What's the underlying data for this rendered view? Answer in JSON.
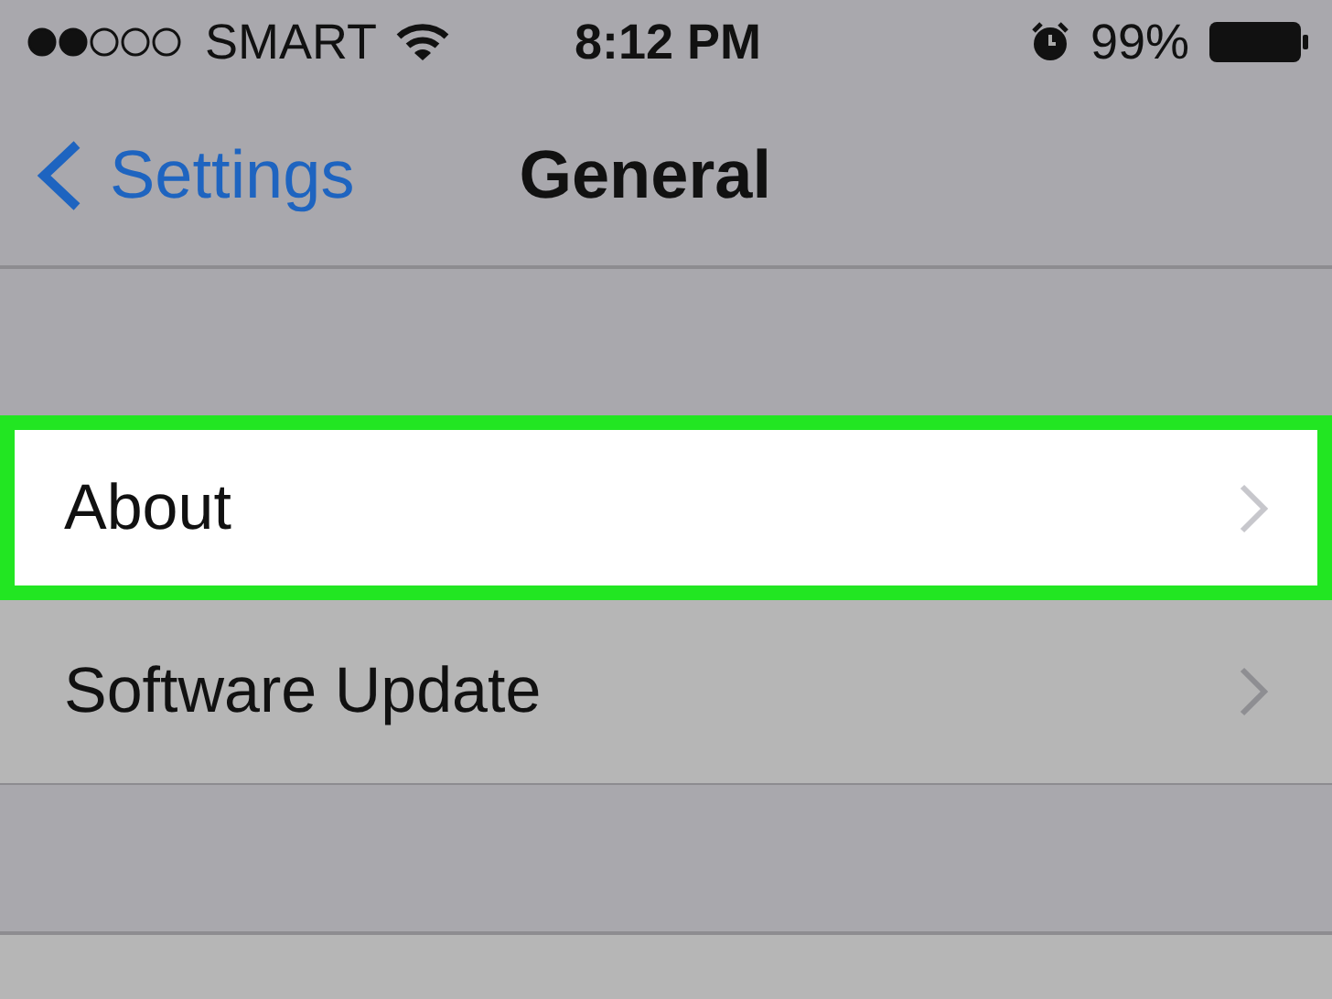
{
  "status_bar": {
    "carrier": "SMART",
    "time": "8:12 PM",
    "battery": "99%"
  },
  "nav": {
    "back_label": "Settings",
    "title": "General"
  },
  "rows": [
    {
      "label": "About",
      "highlighted": true
    },
    {
      "label": "Software Update",
      "highlighted": false
    }
  ]
}
